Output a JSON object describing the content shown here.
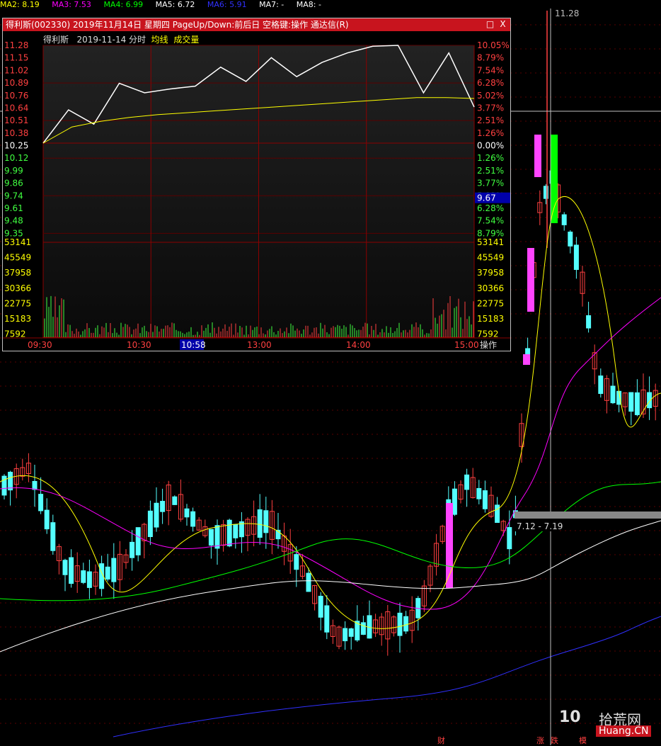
{
  "ma_labels": [
    "MA2: 8.19",
    "MA3: 7.53",
    "MA4: 6.99",
    "MA5: 6.72",
    "MA6: 5.91",
    "MA7: -",
    "MA8: -"
  ],
  "ma_colors": [
    "#ffff00",
    "#ff00ff",
    "#00ff00",
    "#ffffff",
    "#3030ff",
    "#ffffff",
    "#ffffff"
  ],
  "kline": {
    "price_tag": "11.28",
    "range_label": "7.12 - 7.19",
    "watermark_num": "10",
    "watermark_cn": "拾荒网",
    "watermark_en": "Huang.CN",
    "marks": [
      "财",
      "涨",
      "跌",
      "模"
    ]
  },
  "popup": {
    "title": "得利斯(002330) 2019年11月14日 星期四 PageUp/Down:前后日 空格键:操作 通达信(R)",
    "subtitle_name": "得利斯",
    "subtitle_date": "2019-11-14 分时",
    "legend_avg": "均线",
    "legend_vol": "成交量",
    "btn_restore": "□",
    "btn_close": "X",
    "op_label": "操作"
  },
  "chart_data": [
    {
      "type": "line",
      "title": "得利斯 2019-11-14 分时",
      "x_ticks": [
        "09:30",
        "10:30",
        "10:58",
        "13:00",
        "14:00",
        "15:00"
      ],
      "price_ticks": [
        "11.28",
        "11.15",
        "11.02",
        "10.89",
        "10.76",
        "10.64",
        "10.51",
        "10.38",
        "10.25",
        "10.12",
        "9.99",
        "9.86",
        "9.74",
        "9.61",
        "9.48",
        "9.35"
      ],
      "pct_ticks": [
        "10.05%",
        "8.79%",
        "7.54%",
        "6.28%",
        "5.02%",
        "3.77%",
        "2.51%",
        "1.26%",
        "0.00%",
        "1.26%",
        "2.51%",
        "3.77%",
        "5.02%",
        "6.28%",
        "7.54%",
        "8.79%"
      ],
      "vol_ticks": [
        "53141",
        "45549",
        "37958",
        "30366",
        "22775",
        "15183",
        "7592"
      ],
      "prev_close": 10.25,
      "cursor_value": "9.67",
      "ylim": [
        9.22,
        11.28
      ],
      "series": [
        {
          "name": "均线",
          "values": [
            10.25,
            10.42,
            10.48,
            10.52,
            10.55,
            10.57,
            10.59,
            10.61,
            10.63,
            10.65,
            10.67,
            10.69,
            10.71,
            10.73,
            10.73,
            10.72
          ]
        },
        {
          "values": [
            10.25,
            10.6,
            10.45,
            10.88,
            10.78,
            10.82,
            10.85,
            11.05,
            10.9,
            11.15,
            10.95,
            11.1,
            11.2,
            11.27,
            11.28,
            10.78,
            11.2,
            10.63
          ]
        }
      ]
    },
    {
      "type": "candlestick",
      "price_high": 11.28,
      "zone_low": 7.12,
      "zone_high": 7.19
    }
  ]
}
